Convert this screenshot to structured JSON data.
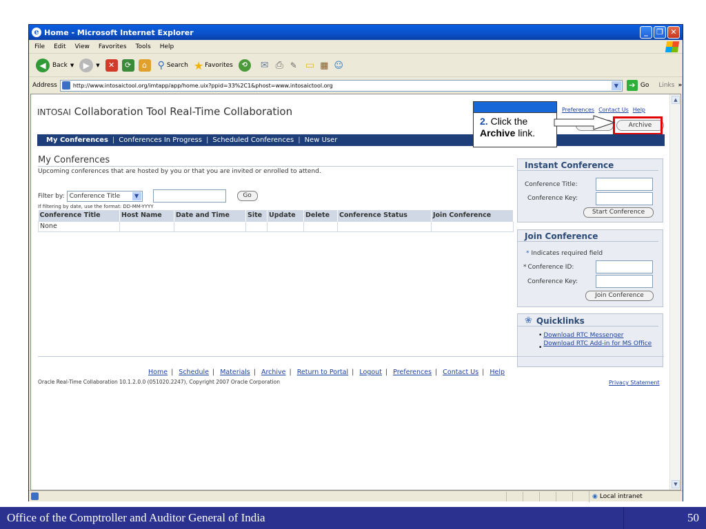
{
  "browser": {
    "title": "Home - Microsoft Internet Explorer",
    "menu": [
      "File",
      "Edit",
      "View",
      "Favorites",
      "Tools",
      "Help"
    ],
    "toolbar": {
      "back": "Back",
      "search": "Search",
      "favorites": "Favorites"
    },
    "address_label": "Address",
    "url": "http://www.intosaictool.org/imtapp/app/home.uix?ppid=33%2C1&phost=www.intosaictool.org",
    "go": "Go",
    "links": "Links",
    "status_zone": "Local intranet"
  },
  "app": {
    "title_brand": "INTOSAI",
    "title_rest": " Collaboration Tool Real-Time Collaboration",
    "top_links": [
      "Preferences",
      "Contact Us",
      "Help"
    ],
    "archive_button": "Archive",
    "nav": [
      "My Conferences",
      "Conferences In Progress",
      "Scheduled Conferences",
      "New User"
    ]
  },
  "callout": {
    "step": "2.",
    "text1": " Click the",
    "bold": "Archive",
    "text2": " link."
  },
  "main": {
    "heading": "My Conferences",
    "subtitle": "Upcoming conferences that are hosted by you or that you are invited or enrolled to attend.",
    "filter_label": "Filter by:",
    "filter_value": "Conference Title",
    "go_button": "Go",
    "date_hint": "If filtering by date, use the format: DD-MM-YYYY",
    "columns": [
      "Conference Title",
      "Host Name",
      "Date and Time",
      "Site",
      "Update",
      "Delete",
      "Conference Status",
      "Join Conference"
    ],
    "empty_row": "None"
  },
  "instant": {
    "title": "Instant Conference",
    "title_label": "Conference Title:",
    "key_label": "Conference Key:",
    "button": "Start Conference"
  },
  "join": {
    "title": "Join Conference",
    "required_note": "Indicates required field",
    "id_label": "Conference ID:",
    "key_label": "Conference Key:",
    "button": "Join Conference"
  },
  "quicklinks": {
    "title": "Quicklinks",
    "items": [
      "Download RTC Messenger",
      "Download RTC Add-in for MS Office"
    ]
  },
  "footer": {
    "links": [
      "Home",
      "Schedule",
      "Materials",
      "Archive",
      "Return to Portal",
      "Logout",
      "Preferences",
      "Contact Us",
      "Help"
    ],
    "copyright": "Oracle Real-Time Collaboration 10.1.2.0.0 (051020.2247), Copyright 2007 Oracle Corporation",
    "privacy": "Privacy Statement"
  },
  "slide": {
    "org": "Office of the Comptroller and Auditor General of India",
    "page": "50"
  },
  "colors": {
    "nav_bg": "#1d3e79",
    "highlight": "#e00000",
    "slide_footer": "#2b318f",
    "titlebar": "#0b50c8"
  }
}
